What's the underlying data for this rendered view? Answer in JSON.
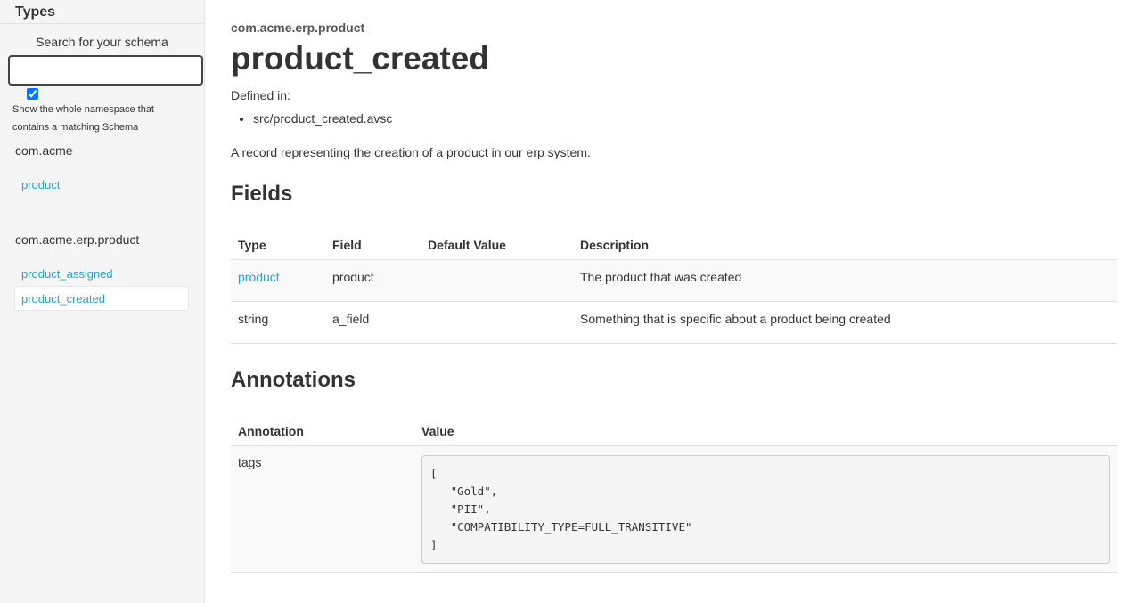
{
  "sidebar": {
    "title": "Types",
    "search_label": "Search for your schema",
    "search_value": "",
    "show_namespace_checked": true,
    "show_namespace_label": "Show the whole namespace that contains a matching Schema",
    "namespaces": [
      {
        "name": "com.acme",
        "items": [
          "product"
        ]
      },
      {
        "name": "com.acme.erp.product",
        "items": [
          "product_assigned",
          "product_created"
        ],
        "active": "product_created"
      }
    ]
  },
  "main": {
    "namespace": "com.acme.erp.product",
    "title": "product_created",
    "defined_in_label": "Defined in:",
    "defined_in": [
      "src/product_created.avsc"
    ],
    "description": "A record representing the creation of a product in our erp system.",
    "fields": {
      "heading": "Fields",
      "columns": [
        "Type",
        "Field",
        "Default Value",
        "Description"
      ],
      "rows": [
        {
          "type": "product",
          "type_is_link": true,
          "field": "product",
          "default": "",
          "description": "The product that was created"
        },
        {
          "type": "string",
          "type_is_link": false,
          "field": "a_field",
          "default": "",
          "description": "Something that is specific about a product being created"
        }
      ]
    },
    "annotations": {
      "heading": "Annotations",
      "columns": [
        "Annotation",
        "Value"
      ],
      "rows": [
        {
          "annotation": "tags",
          "value": "[\n   \"Gold\",\n   \"PII\",\n   \"COMPATIBILITY_TYPE=FULL_TRANSITIVE\"\n]"
        }
      ]
    }
  },
  "colors": {
    "link": "#2a9fd6",
    "sidebar_bg": "#f5f5f5",
    "text": "#333333"
  }
}
